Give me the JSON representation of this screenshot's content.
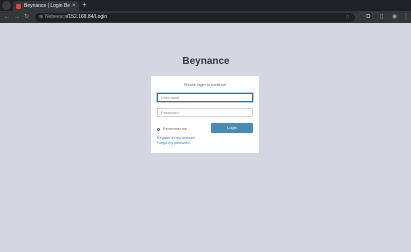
{
  "browser": {
    "tab_title": "Beynance | Login Beynance",
    "tab_close": "×",
    "new_tab": "+",
    "url_host": "Nebeesca",
    "url_path": "/152.168.84/Login",
    "nav_back": "←",
    "nav_forward": "→",
    "nav_reload": "↻",
    "lock_icon": "⊜",
    "star_icon": "☆",
    "menu_icon": "⋮"
  },
  "page": {
    "brand": "Beynance",
    "login_message": "Please login to continue",
    "username_placeholder": "Username",
    "password_placeholder": "Password",
    "remember_label": "Remember me",
    "login_button": "Login",
    "register_link": "Register a new account",
    "forgot_link": "Forgot my password"
  },
  "colors": {
    "background": "#d4d7e1",
    "accent": "#4a8ab1",
    "link": "#3d7ab0"
  }
}
